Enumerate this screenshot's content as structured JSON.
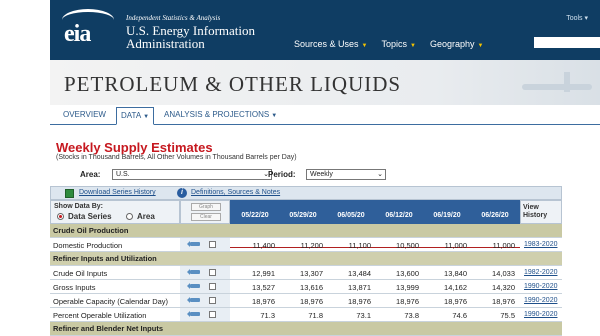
{
  "header": {
    "logo_text": "eia",
    "tagline": "Independent Statistics & Analysis",
    "agency_line1": "U.S. Energy Information",
    "agency_line2": "Administration",
    "tools": "Tools",
    "nav": [
      "Sources & Uses",
      "Topics",
      "Geography"
    ]
  },
  "banner": {
    "title": "PETROLEUM & OTHER LIQUIDS"
  },
  "subnav": {
    "overview": "OVERVIEW",
    "data": "DATA",
    "analysis": "ANALYSIS & PROJECTIONS"
  },
  "page": {
    "title": "Weekly Supply Estimates",
    "subtitle": "(Stocks in Thousand Barrels, All Other Volumes in Thousand Barrels per Day)",
    "area_label": "Area:",
    "area_value": "U.S.",
    "period_label": "Period:",
    "period_value": "Weekly"
  },
  "table": {
    "download_link": "Download Series History",
    "definitions_link": "Definitions, Sources & Notes",
    "show_data_by": "Show Data By:",
    "data_series": "Data Series",
    "area": "Area",
    "graph_btn": "Graph",
    "clear_btn": "Clear",
    "dates": [
      "05/22/20",
      "05/29/20",
      "06/05/20",
      "06/12/20",
      "06/19/20",
      "06/26/20"
    ],
    "view_history": "View History",
    "sections": [
      {
        "name": "Crude Oil Production"
      },
      {
        "name": "Refiner Inputs and Utilization"
      },
      {
        "name": "Refiner and Blender Net Inputs"
      }
    ],
    "rows": [
      {
        "label": "Domestic Production",
        "values": [
          "11,400",
          "11,200",
          "11,100",
          "10,500",
          "11,000",
          "11,000"
        ],
        "history": "1983-2020"
      },
      {
        "label": "Crude Oil Inputs",
        "values": [
          "12,991",
          "13,307",
          "13,484",
          "13,600",
          "13,840",
          "14,033"
        ],
        "history": "1982-2020"
      },
      {
        "label": "Gross Inputs",
        "values": [
          "13,527",
          "13,616",
          "13,871",
          "13,999",
          "14,162",
          "14,320"
        ],
        "history": "1990-2020"
      },
      {
        "label": "Operable Capacity (Calendar Day)",
        "values": [
          "18,976",
          "18,976",
          "18,976",
          "18,976",
          "18,976",
          "18,976"
        ],
        "history": "1990-2020"
      },
      {
        "label": "Percent Operable Utilization",
        "values": [
          "71.3",
          "71.8",
          "73.1",
          "73.8",
          "74.6",
          "75.5"
        ],
        "history": "1990-2020"
      }
    ]
  }
}
